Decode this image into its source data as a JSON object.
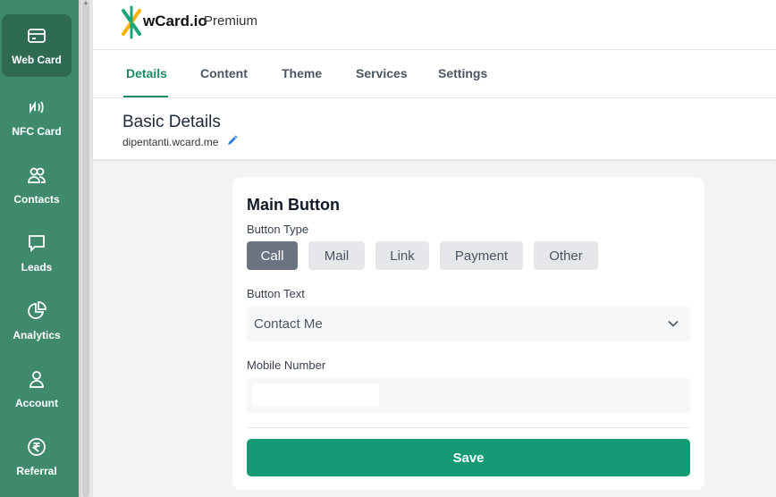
{
  "sidebar": {
    "items": [
      {
        "label": "Web Card",
        "icon": "card-icon"
      },
      {
        "label": "NFC Card",
        "icon": "nfc-icon"
      },
      {
        "label": "Contacts",
        "icon": "contacts-icon"
      },
      {
        "label": "Leads",
        "icon": "chat-icon"
      },
      {
        "label": "Analytics",
        "icon": "pie-chart-icon"
      },
      {
        "label": "Account",
        "icon": "user-icon"
      },
      {
        "label": "Referral",
        "icon": "rupee-icon"
      }
    ]
  },
  "header": {
    "brand": "wCard.io",
    "plan": "Premium"
  },
  "tabs": [
    {
      "label": "Details"
    },
    {
      "label": "Content"
    },
    {
      "label": "Theme"
    },
    {
      "label": "Services"
    },
    {
      "label": "Settings"
    }
  ],
  "basic": {
    "title": "Basic Details",
    "url": "dipentanti.wcard.me"
  },
  "card": {
    "title": "Main Button",
    "button_type_label": "Button Type",
    "types": [
      "Call",
      "Mail",
      "Link",
      "Payment",
      "Other"
    ],
    "button_text_label": "Button Text",
    "button_text_value": "Contact Me",
    "mobile_label": "Mobile Number",
    "mobile_value": "",
    "save_label": "Save"
  },
  "colors": {
    "sidebar": "#3f8a6c",
    "accent": "#149a74",
    "active_tab": "#1e8a68"
  }
}
